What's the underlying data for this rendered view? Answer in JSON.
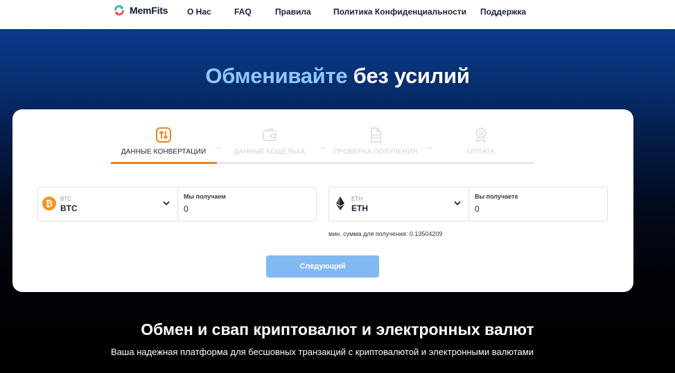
{
  "header": {
    "logo_text": "MemFits",
    "nav": [
      {
        "label": "О Нас"
      },
      {
        "label": "FAQ"
      },
      {
        "label": "Правила"
      },
      {
        "label": "Политика Конфиденциальности"
      },
      {
        "label": "Поддержка"
      }
    ]
  },
  "hero": {
    "title_accent": "Обменивайте",
    "title_rest": "без усилий"
  },
  "steps": [
    {
      "label": "ДАННЫЕ КОНВЕРТАЦИИ",
      "icon": "swap-arrows-icon",
      "active": true
    },
    {
      "label": "ДАННЫЕ КОШЕЛЬКА",
      "icon": "wallet-icon",
      "active": false
    },
    {
      "label": "ПРОВЕРКА ПОЛУЧЕНИЯ",
      "icon": "document-check-icon",
      "active": false
    },
    {
      "label": "ОПЛАТА",
      "icon": "payment-badge-icon",
      "active": false
    }
  ],
  "progress": {
    "completed_steps": 1,
    "total_steps": 4
  },
  "exchange": {
    "from": {
      "coin_sub": "BTC",
      "coin_name": "BTC",
      "icon": "bitcoin-icon",
      "field_label": "Мы получаем",
      "value": "0"
    },
    "to": {
      "coin_sub": "ETH",
      "coin_name": "ETH",
      "icon": "ethereum-icon",
      "field_label": "Вы получаете",
      "value": "0"
    },
    "min_note": "мин. сумма для получения: 0.13504209"
  },
  "next_button": {
    "label": "Следующий"
  },
  "footer": {
    "title": "Обмен и свап криптовалют и электронных валют",
    "subtitle": "Ваша надежная платформа для бесшовных транзакций с криптовалютой и электронными валютами"
  },
  "colors": {
    "accent_orange": "#e7842a",
    "button_blue": "#82b8f3",
    "hero_accent": "#8ec9ff",
    "bitcoin": "#f7931a"
  }
}
